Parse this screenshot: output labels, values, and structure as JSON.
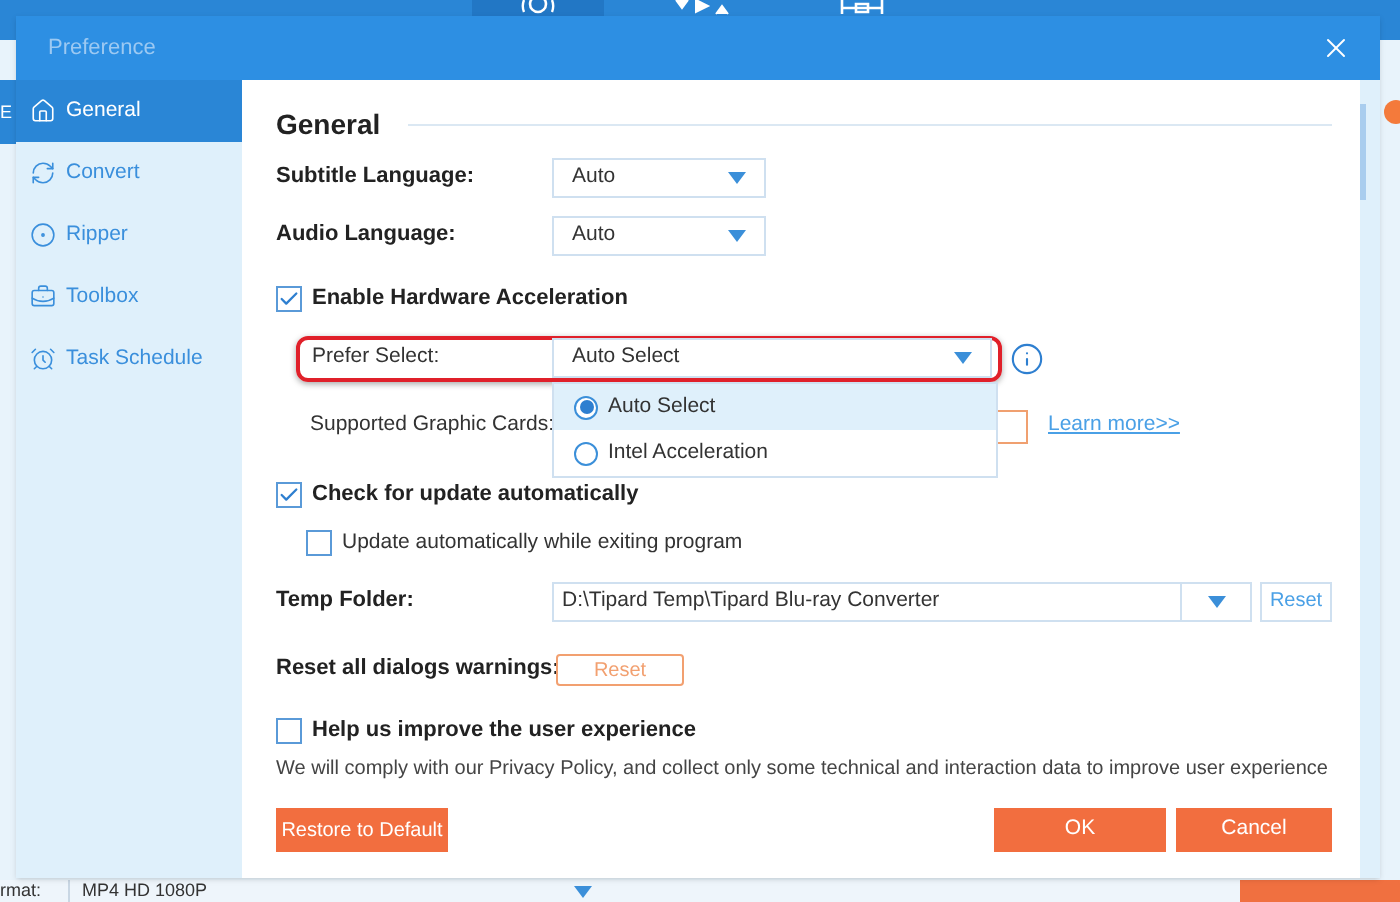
{
  "app_background": {
    "left_label": "E",
    "format_label": "rmat:",
    "format_value": "MP4 HD 1080P"
  },
  "dialog": {
    "title": "Preference"
  },
  "sidebar": {
    "items": [
      {
        "label": "General",
        "selected": true
      },
      {
        "label": "Convert",
        "selected": false
      },
      {
        "label": "Ripper",
        "selected": false
      },
      {
        "label": "Toolbox",
        "selected": false
      },
      {
        "label": "Task Schedule",
        "selected": false
      }
    ]
  },
  "section_title": "General",
  "subtitle_language": {
    "label": "Subtitle Language:",
    "value": "Auto"
  },
  "audio_language": {
    "label": "Audio Language:",
    "value": "Auto"
  },
  "hardware_acceleration": {
    "label": "Enable Hardware Acceleration",
    "checked": true
  },
  "prefer_select": {
    "label": "Prefer Select:",
    "value": "Auto Select",
    "expanded": true,
    "options": [
      {
        "label": "Auto Select",
        "selected": true
      },
      {
        "label": "Intel Acceleration",
        "selected": false
      }
    ]
  },
  "graphic_cards": {
    "label": "Supported Graphic Cards:",
    "link": "Learn more>>"
  },
  "check_update": {
    "label": "Check for update automatically",
    "checked": true
  },
  "auto_update": {
    "label": "Update automatically while exiting program",
    "checked": false
  },
  "temp_folder": {
    "label": "Temp Folder:",
    "value": "D:\\Tipard Temp\\Tipard Blu-ray Converter",
    "reset": "Reset"
  },
  "reset_warnings": {
    "label": "Reset all dialogs warnings:",
    "button": "Reset"
  },
  "improve": {
    "label": "Help us improve the user experience",
    "checked": false
  },
  "privacy_note": "We will comply with our Privacy Policy, and collect only some technical and interaction data to improve user experience",
  "buttons": {
    "restore": "Restore to Default",
    "ok": "OK",
    "cancel": "Cancel"
  }
}
